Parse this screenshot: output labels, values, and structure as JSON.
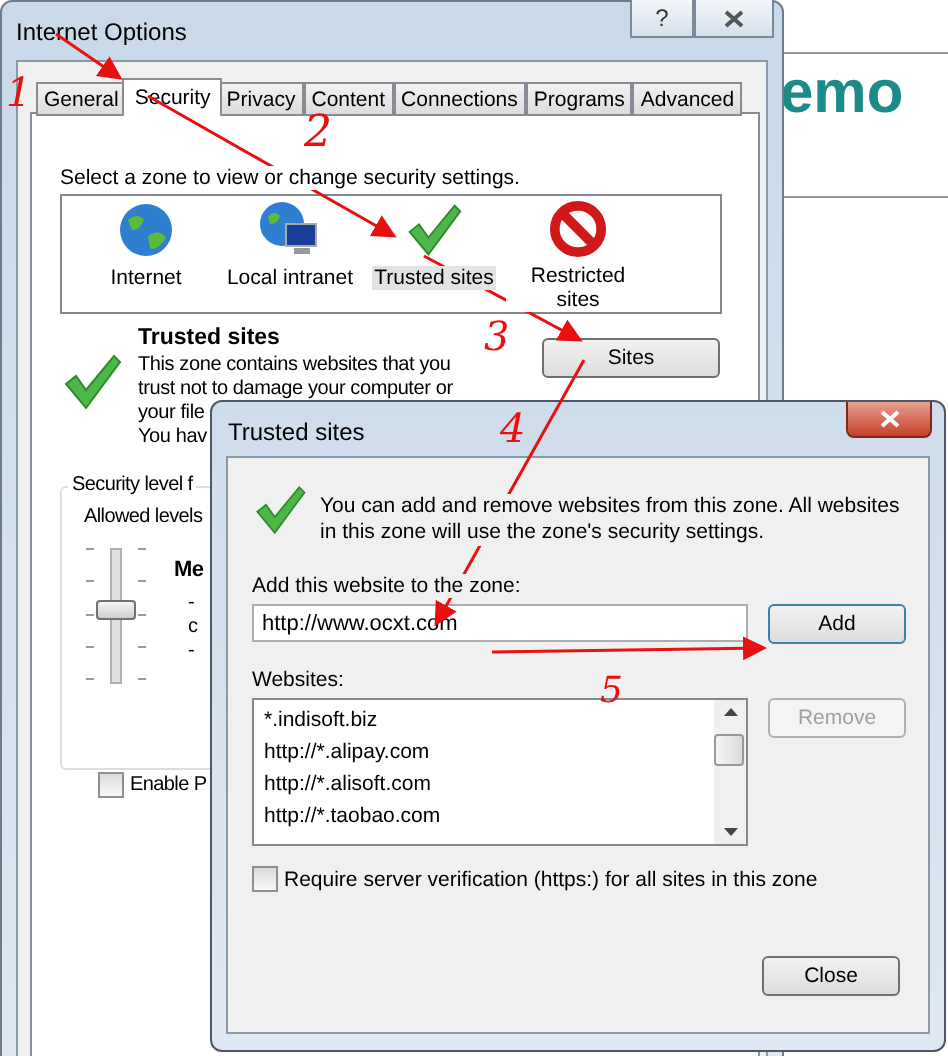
{
  "background_page": {
    "heading": "emo"
  },
  "main_window": {
    "title": "Internet Options",
    "help_button": "?",
    "tabs": [
      {
        "label": "General",
        "selected": false
      },
      {
        "label": "Security",
        "selected": true
      },
      {
        "label": "Privacy",
        "selected": false
      },
      {
        "label": "Content",
        "selected": false
      },
      {
        "label": "Connections",
        "selected": false
      },
      {
        "label": "Programs",
        "selected": false
      },
      {
        "label": "Advanced",
        "selected": false
      }
    ],
    "zone_prompt": "Select a zone to view or change security settings.",
    "zones": [
      {
        "label": "Internet",
        "kind": "internet",
        "selected": false
      },
      {
        "label": "Local intranet",
        "kind": "intranet",
        "selected": false
      },
      {
        "label": "Trusted sites",
        "kind": "trusted",
        "selected": true
      },
      {
        "label": "Restricted sites",
        "kind": "restricted",
        "selected": false
      }
    ],
    "zone_title": "Trusted sites",
    "zone_description": [
      "This zone contains websites that you",
      "trust not to damage your computer or",
      "your file",
      "You hav"
    ],
    "sites_button": "Sites",
    "security_level": {
      "group_label": "Security level f",
      "allowed_label": "Allowed levels",
      "level_name": "Me",
      "notes": [
        "-",
        "c",
        "-"
      ],
      "level": 0.5
    },
    "enable_checkbox": {
      "label": "Enable P",
      "checked": false
    }
  },
  "dialog": {
    "title": "Trusted sites",
    "info": "You can add and remove websites from this zone. All websites in this zone will use the zone's security settings.",
    "add_label": "Add this website to the zone:",
    "add_value": "http://www.ocxt.com",
    "add_button": "Add",
    "websites_label": "Websites:",
    "websites": [
      "*.indisoft.biz",
      "http://*.alipay.com",
      "http://*.alisoft.com",
      "http://*.taobao.com"
    ],
    "remove_button": {
      "label": "Remove",
      "disabled": true
    },
    "https_checkbox": {
      "label": "Require server verification (https:) for all sites in this zone",
      "checked": false
    },
    "close_button": "Close"
  },
  "annotations": [
    {
      "number": "1"
    },
    {
      "number": "2"
    },
    {
      "number": "3"
    },
    {
      "number": "4"
    },
    {
      "number": "5"
    }
  ]
}
